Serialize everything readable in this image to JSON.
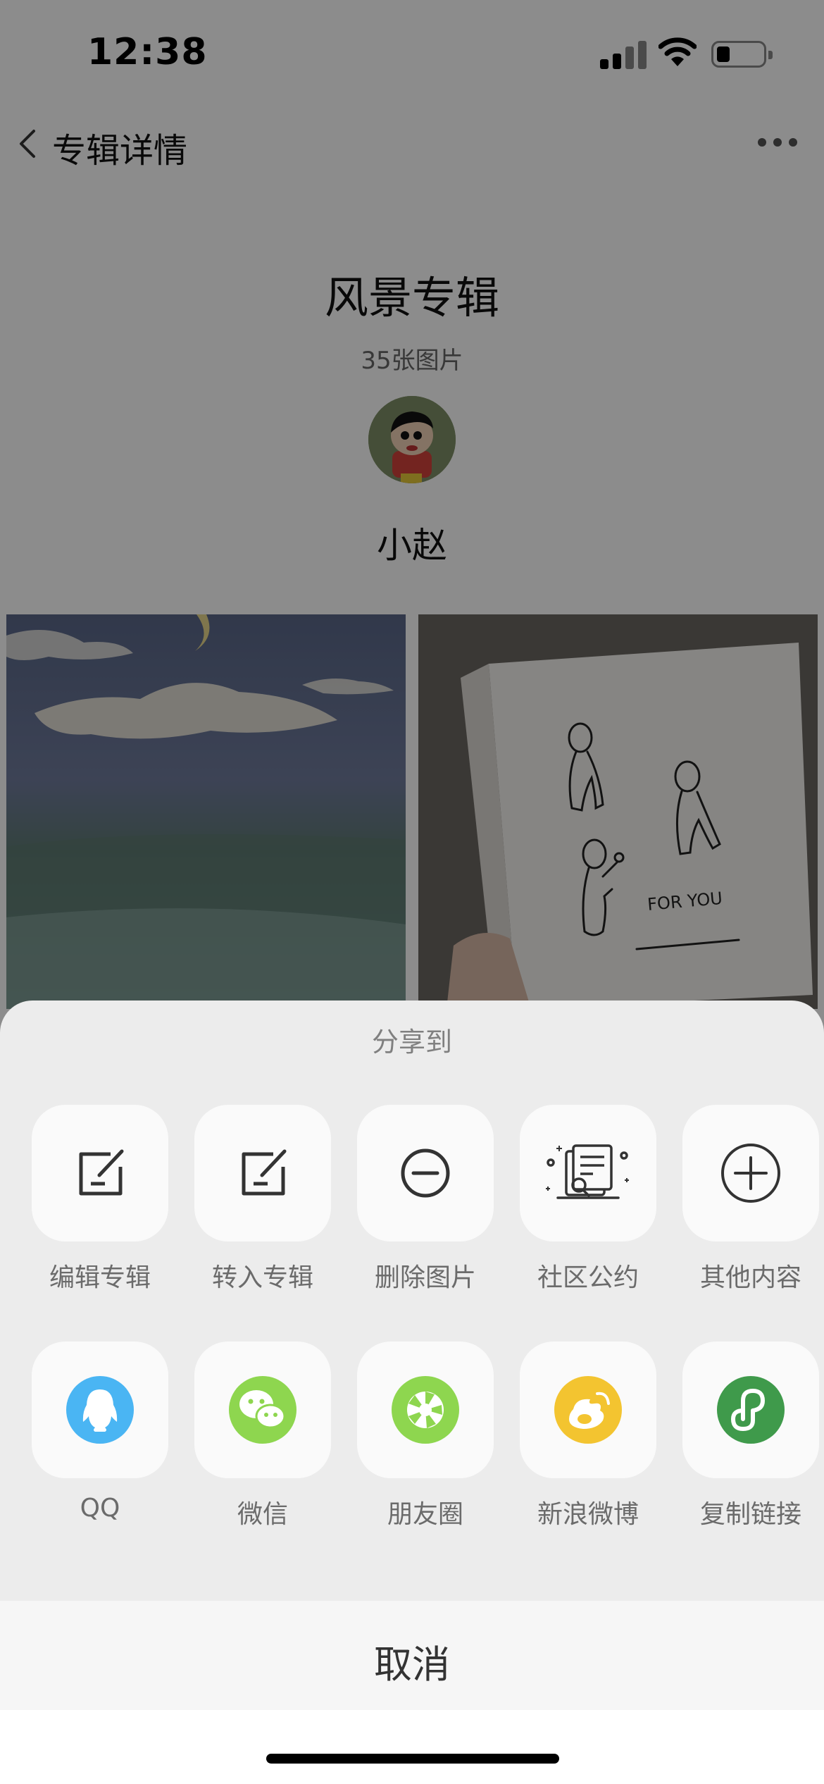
{
  "status_bar": {
    "time": "12:38"
  },
  "nav": {
    "title": "专辑详情"
  },
  "album": {
    "title": "风景专辑",
    "count": "35张图片",
    "author": "小赵"
  },
  "photos": {
    "handwriting": "FOR YOU"
  },
  "share_sheet": {
    "title": "分享到",
    "row1": [
      {
        "label": "编辑专辑",
        "icon": "edit-icon"
      },
      {
        "label": "转入专辑",
        "icon": "move-to-album-icon"
      },
      {
        "label": "删除图片",
        "icon": "minus-circle-icon"
      },
      {
        "label": "社区公约",
        "icon": "community-rules-icon"
      },
      {
        "label": "其他内容",
        "icon": "plus-circle-icon"
      }
    ],
    "row2": [
      {
        "label": "QQ",
        "icon": "qq-icon",
        "color": "#4ab5f3"
      },
      {
        "label": "微信",
        "icon": "wechat-icon",
        "color": "#8ed64f"
      },
      {
        "label": "朋友圈",
        "icon": "moments-icon",
        "color": "#8ed64f"
      },
      {
        "label": "新浪微博",
        "icon": "weibo-icon",
        "color": "#f3c430"
      },
      {
        "label": "复制链接",
        "icon": "mini-program-link-icon",
        "color": "#3f9a4b"
      }
    ],
    "cancel_label": "取消"
  }
}
